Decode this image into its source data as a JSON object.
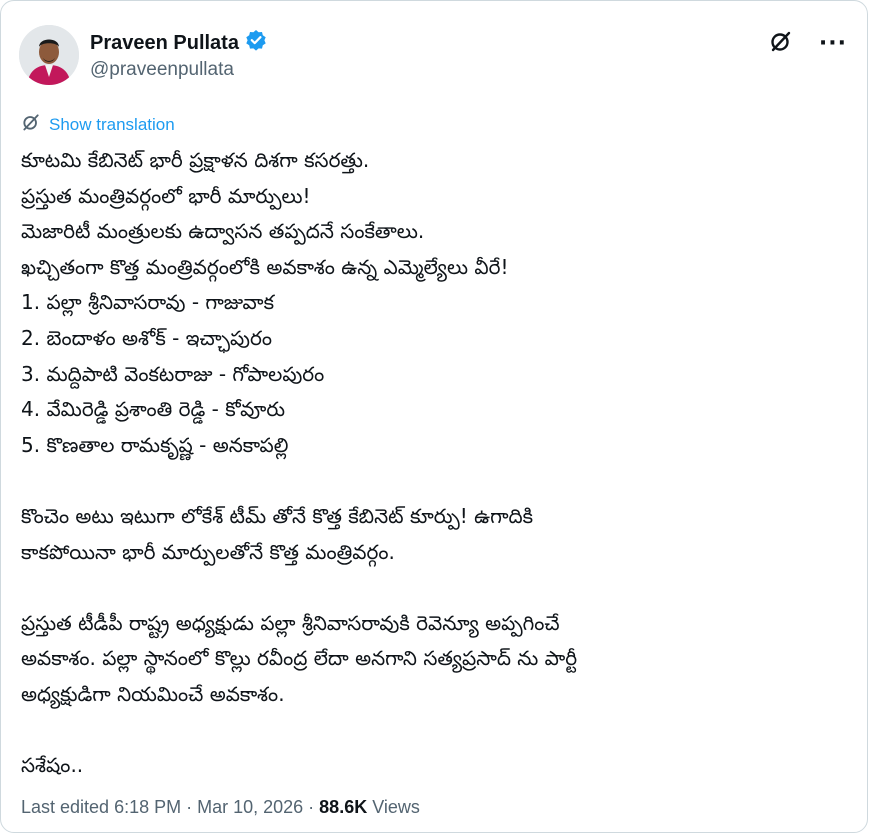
{
  "author": {
    "name": "Praveen Pullata",
    "handle": "@praveenpullata",
    "verified": true
  },
  "header_icons": [
    "grok-icon",
    "more-icon"
  ],
  "more_label": "···",
  "translate": {
    "label": "Show translation"
  },
  "tweet_lines": [
    "కూటమి కేబినెట్ భారీ ప్రక్షాళన దిశగా కసరత్తు.",
    "ప్రస్తుత మంత్రివర్గంలో  భారీ మార్పులు!",
    "మెజారిటీ మంత్రులకు ఉద్వాసన తప్పదనే సంకేతాలు.",
    "ఖచ్చితంగా కొత్త మంత్రివర్గంలోకి అవకాశం ఉన్న ఎమ్మెల్యేలు వీరే!",
    "1. పల్లా శ్రీనివాసరావు - గాజువాక",
    "2. బెందాళం  అశోక్ - ఇచ్ఛాపురం",
    "3. మద్దిపాటి వెంకటరాజు - గోపాలపురం",
    "4. వేమిరెడ్డి ప్రశాంతి రెడ్డి - కోవూరు",
    "5. కొణతాల రామకృష్ణ - అనకాపల్లి",
    "",
    "కొంచెం అటు ఇటుగా లోకేశ్ టీమ్ తోనే కొత్త కేబినెట్ కూర్పు! ఉగాదికి",
    "కాకపోయినా భారీ మార్పులతోనే కొత్త మంత్రివర్గం.",
    "",
    "ప్రస్తుత టీడీపీ రాష్ట్ర అధ్యక్షుడు పల్లా శ్రీనివాసరావుకి రెవెన్యూ  అప్పగించే",
    "అవకాశం. పల్లా స్థానంలో కొల్లు రవీంద్ర లేదా అనగాని సత్యప్రసాద్ ను పార్టీ",
    "అధ్యక్షుడిగా నియమించే అవకాశం.",
    "",
    "సశేషం.."
  ],
  "footer": {
    "edited": "Last edited 6:18 PM · Mar 10, 2026 · ",
    "views_count": "88.6K",
    "views_label": " Views"
  },
  "colors": {
    "accent": "#1d9bf0",
    "text": "#0f1419",
    "secondary": "#536471"
  }
}
